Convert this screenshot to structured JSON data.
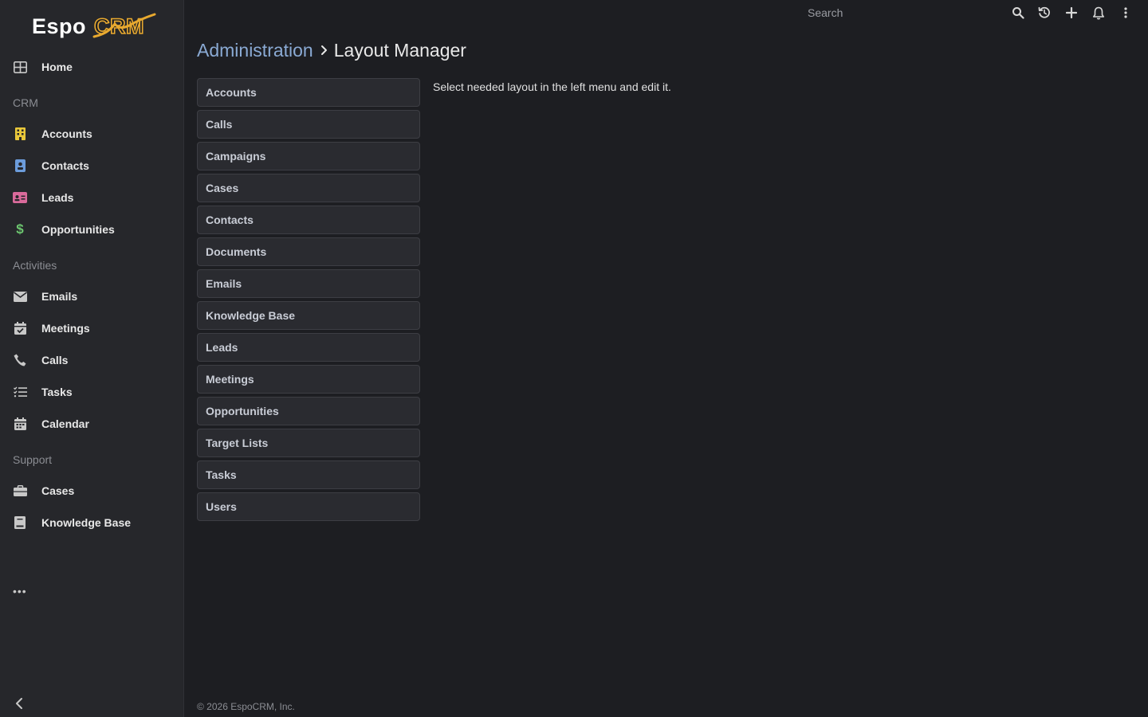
{
  "logo": {
    "part1": "Espo",
    "part2": "CRM"
  },
  "sidebar": {
    "home": {
      "label": "Home",
      "icon": "home-grid-icon"
    },
    "groups": {
      "crm": "CRM",
      "activities": "Activities",
      "support": "Support"
    },
    "crm_items": [
      {
        "label": "Accounts",
        "icon": "building-icon",
        "color": "#e8c73a"
      },
      {
        "label": "Contacts",
        "icon": "id-badge-icon",
        "color": "#6c9cdb"
      },
      {
        "label": "Leads",
        "icon": "id-card-icon",
        "color": "#d96a9b"
      },
      {
        "label": "Opportunities",
        "icon": "dollar-icon",
        "color": "#6cc56f"
      }
    ],
    "activity_items": [
      {
        "label": "Emails",
        "icon": "envelope-icon"
      },
      {
        "label": "Meetings",
        "icon": "calendar-check-icon"
      },
      {
        "label": "Calls",
        "icon": "phone-icon"
      },
      {
        "label": "Tasks",
        "icon": "tasks-icon"
      },
      {
        "label": "Calendar",
        "icon": "calendar-icon"
      }
    ],
    "support_items": [
      {
        "label": "Cases",
        "icon": "briefcase-icon"
      },
      {
        "label": "Knowledge Base",
        "icon": "book-icon"
      }
    ],
    "more": "•••"
  },
  "topbar": {
    "search_placeholder": "Search"
  },
  "breadcrumb": {
    "parent": "Administration",
    "current": "Layout Manager"
  },
  "layouts": [
    "Accounts",
    "Calls",
    "Campaigns",
    "Cases",
    "Contacts",
    "Documents",
    "Emails",
    "Knowledge Base",
    "Leads",
    "Meetings",
    "Opportunities",
    "Target Lists",
    "Tasks",
    "Users"
  ],
  "hint": "Select needed layout in the left menu and edit it.",
  "footer": "© 2026 EspoCRM, Inc.",
  "colors": {
    "background": "#1d1e22",
    "sidebar": "#26272b",
    "link": "#8aaad4",
    "logo_accent": "#e8a92f"
  }
}
